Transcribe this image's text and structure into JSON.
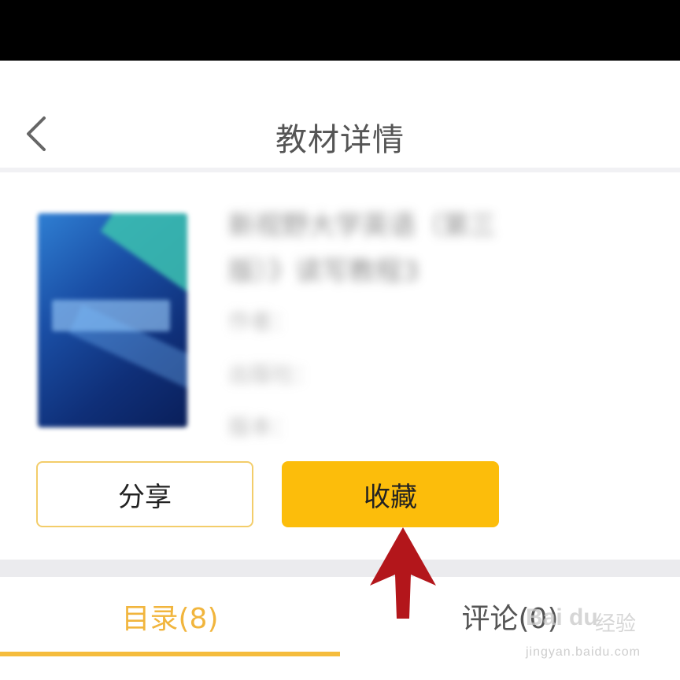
{
  "header": {
    "title": "教材详情",
    "back_icon": "chevron-left-icon"
  },
  "book": {
    "title_line1": "新视野大学英语（第三",
    "title_line2": "版）》读写教程3",
    "author_label": "作者：",
    "publisher_label": "出版社：",
    "edition_label": "版本："
  },
  "actions": {
    "share_label": "分享",
    "favorite_label": "收藏"
  },
  "tabs": [
    {
      "label": "目录(8)",
      "active": true
    },
    {
      "label": "评论(0)",
      "active": false
    }
  ],
  "watermark": {
    "brand": "Bai du",
    "text": "经验",
    "url": "jingyan.baidu.com"
  },
  "colors": {
    "accent": "#fcbd0b",
    "active_tab": "#f1b53d",
    "annotation_arrow": "#b3161b"
  }
}
